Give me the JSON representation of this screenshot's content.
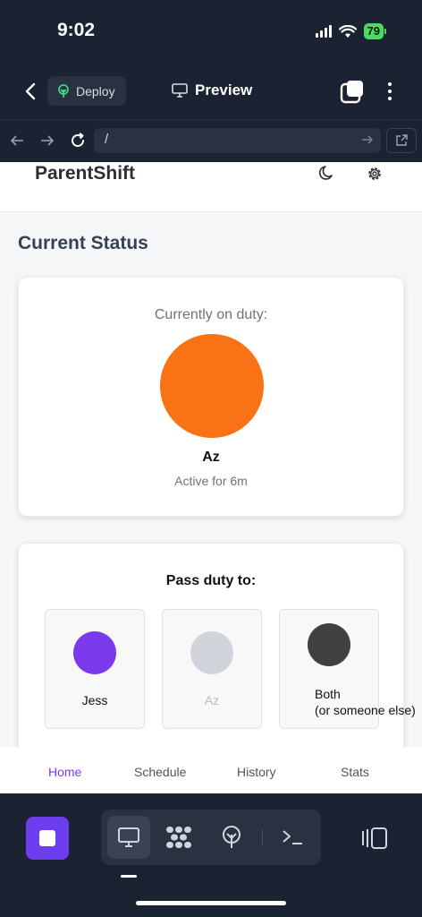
{
  "status_bar": {
    "time": "9:02",
    "battery": "79"
  },
  "app_bar": {
    "deploy_label": "Deploy",
    "title": "Preview"
  },
  "browser": {
    "url": "/"
  },
  "site": {
    "brand": "ParentShift",
    "section_title": "Current Status",
    "current": {
      "label": "Currently on duty:",
      "name": "Az",
      "active": "Active for 6m",
      "color": "#f97316"
    },
    "pass": {
      "title": "Pass duty to:",
      "options": [
        {
          "name": "Jess",
          "color": "#7c3aed",
          "disabled": false
        },
        {
          "name": "Az",
          "color": "#d1d5db",
          "disabled": true
        },
        {
          "name_line1": "Both",
          "name_line2": "(or someone else)",
          "color": "#404040",
          "disabled": false
        }
      ]
    },
    "nav": [
      {
        "label": "Home",
        "active": true
      },
      {
        "label": "Schedule",
        "active": false
      },
      {
        "label": "History",
        "active": false
      },
      {
        "label": "Stats",
        "active": false
      }
    ]
  },
  "colors": {
    "accent": "#7c3aed",
    "chrome_bg": "#1b2231",
    "stop_button": "#6d3ef0"
  },
  "icons": [
    "back-icon",
    "deploy-icon",
    "monitor-icon",
    "tabs-icon",
    "more-icon",
    "arrow-left-icon",
    "arrow-right-icon",
    "reload-icon",
    "url-go-icon",
    "external-link-icon",
    "moon-icon",
    "gear-icon",
    "stop-icon",
    "desktop-icon",
    "apps-icon",
    "deploy-tree-icon",
    "terminal-icon",
    "split-view-icon"
  ]
}
